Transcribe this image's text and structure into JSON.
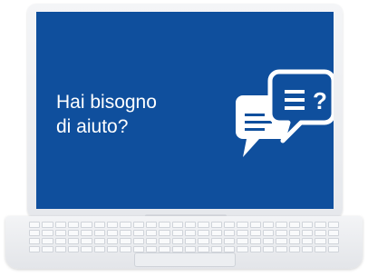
{
  "screen": {
    "headline_line1": "Hai bisogno",
    "headline_line2": "di aiuto?",
    "background_color": "#0f4f9d",
    "icon": "chat-bubbles-question-icon"
  },
  "device": "laptop"
}
